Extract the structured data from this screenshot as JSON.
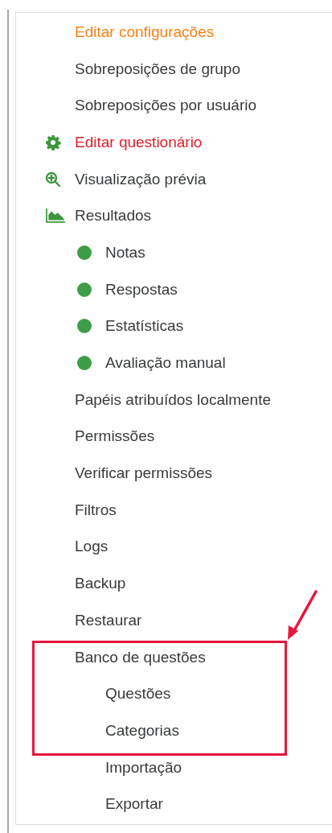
{
  "menu": [
    {
      "label": "Editar configurações",
      "kind": "plain",
      "color": "#f98012"
    },
    {
      "label": "Sobreposições de grupo",
      "kind": "plain",
      "color": "#373a3c"
    },
    {
      "label": "Sobreposições por usuário",
      "kind": "plain",
      "color": "#373a3c"
    },
    {
      "label": "Editar questionário",
      "kind": "settings",
      "color": "#e0202f"
    },
    {
      "label": "Visualização prévia",
      "kind": "preview",
      "color": "#373a3c"
    },
    {
      "label": "Resultados",
      "kind": "report",
      "color": "#373a3c",
      "children": [
        {
          "label": "Notas",
          "kind": "bullet",
          "color": "#373a3c"
        },
        {
          "label": "Respostas",
          "kind": "bullet",
          "color": "#373a3c"
        },
        {
          "label": "Estatísticas",
          "kind": "bullet",
          "color": "#373a3c"
        },
        {
          "label": "Avaliação manual",
          "kind": "bullet",
          "color": "#373a3c"
        }
      ]
    },
    {
      "label": "Papéis atribuídos localmente",
      "kind": "plain",
      "color": "#373a3c"
    },
    {
      "label": "Permissões",
      "kind": "plain",
      "color": "#373a3c"
    },
    {
      "label": "Verificar permissões",
      "kind": "plain",
      "color": "#373a3c"
    },
    {
      "label": "Filtros",
      "kind": "plain",
      "color": "#373a3c"
    },
    {
      "label": "Logs",
      "kind": "plain",
      "color": "#373a3c"
    },
    {
      "label": "Backup",
      "kind": "plain",
      "color": "#373a3c"
    },
    {
      "label": "Restaurar",
      "kind": "plain",
      "color": "#373a3c"
    },
    {
      "label": "Banco de questões",
      "kind": "plain",
      "color": "#373a3c",
      "highlighted": true,
      "children": [
        {
          "label": "Questões",
          "kind": "plain",
          "color": "#373a3c",
          "highlighted": true
        },
        {
          "label": "Categorias",
          "kind": "plain",
          "color": "#373a3c",
          "highlighted": true
        },
        {
          "label": "Importação",
          "kind": "plain",
          "color": "#373a3c"
        },
        {
          "label": "Exportar",
          "kind": "plain",
          "color": "#373a3c"
        }
      ]
    }
  ]
}
